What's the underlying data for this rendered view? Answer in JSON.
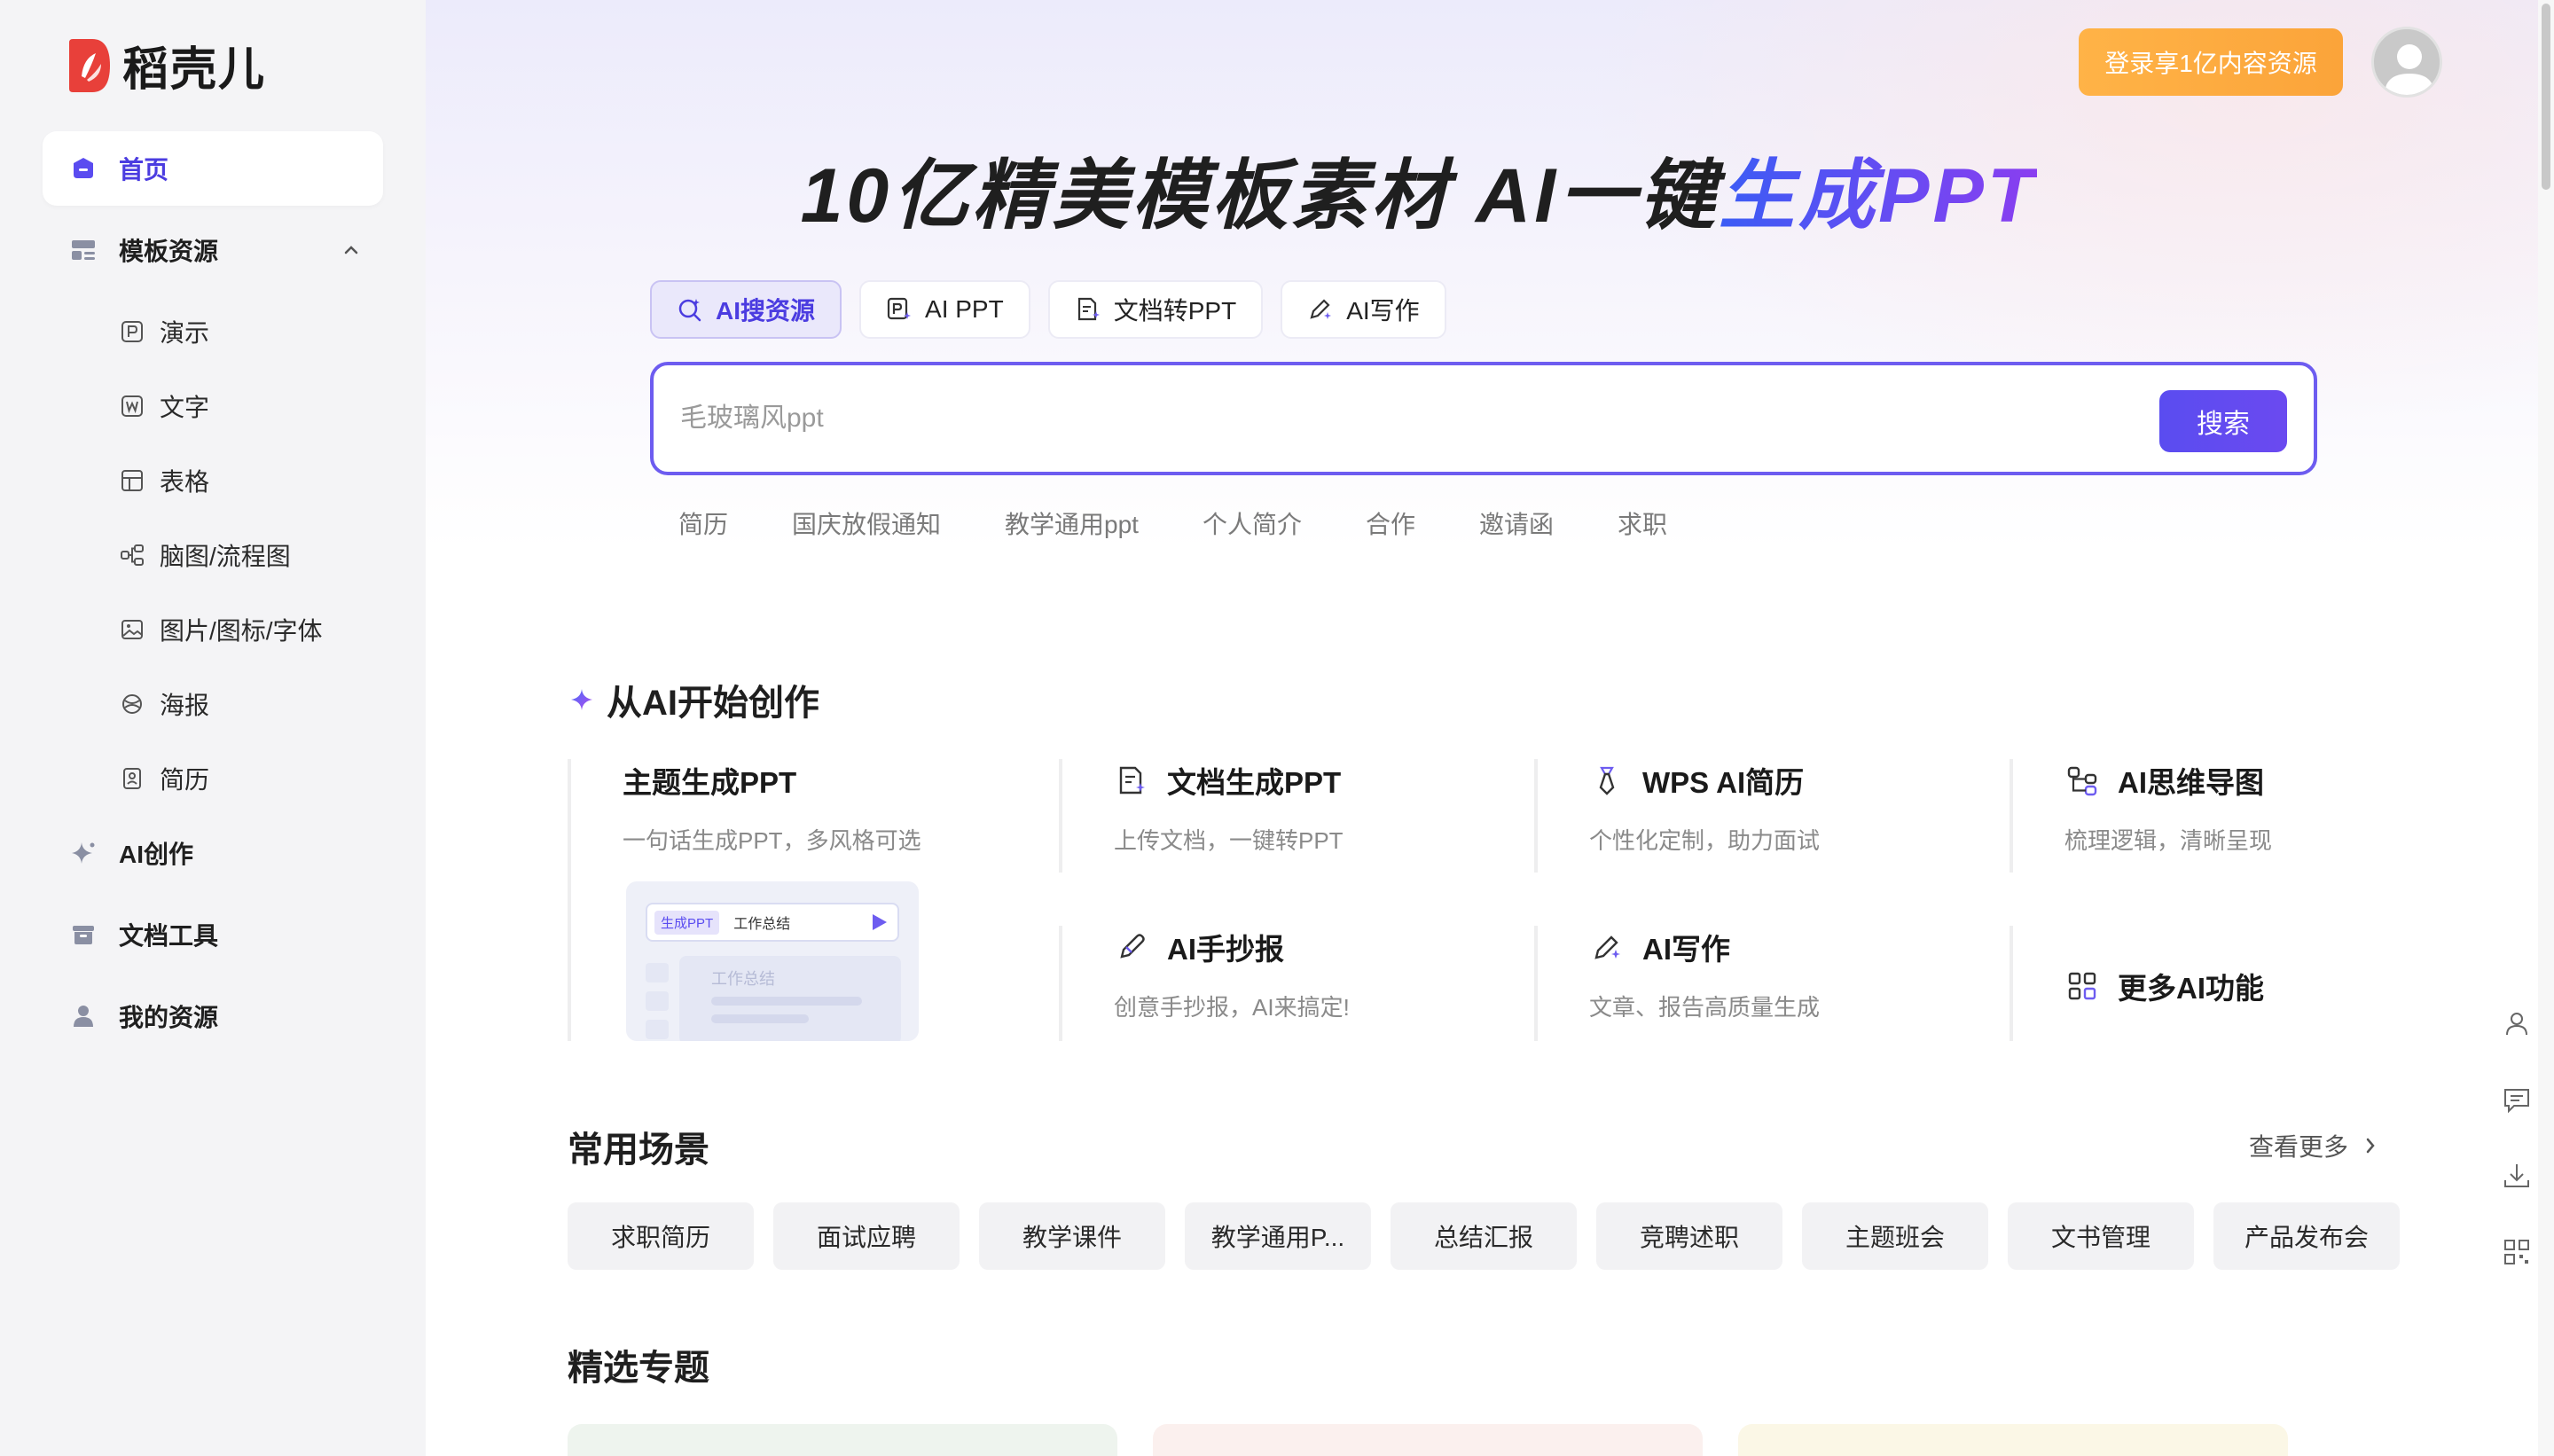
{
  "brand": {
    "name": "稻壳儿"
  },
  "sidebar": {
    "items": [
      {
        "label": "首页",
        "icon": "home-icon",
        "active": true
      },
      {
        "label": "模板资源",
        "icon": "template-icon",
        "expanded": true
      },
      {
        "label": "AI创作",
        "icon": "sparkle-icon"
      },
      {
        "label": "文档工具",
        "icon": "toolbox-icon"
      },
      {
        "label": "我的资源",
        "icon": "user-icon"
      }
    ],
    "sub_items": [
      {
        "label": "演示",
        "icon": "presentation-icon"
      },
      {
        "label": "文字",
        "icon": "word-doc-icon"
      },
      {
        "label": "表格",
        "icon": "table-icon"
      },
      {
        "label": "脑图/流程图",
        "icon": "mindmap-icon"
      },
      {
        "label": "图片/图标/字体",
        "icon": "image-icon"
      },
      {
        "label": "海报",
        "icon": "poster-icon"
      },
      {
        "label": "简历",
        "icon": "resume-icon"
      }
    ]
  },
  "header": {
    "login_label": "登录享1亿内容资源",
    "title_main": "10亿精美模板素材 AI一键",
    "title_accent": "生成PPT"
  },
  "search": {
    "tabs": [
      {
        "label": "AI搜资源",
        "icon": "ai-search-icon",
        "active": true
      },
      {
        "label": "AI PPT",
        "icon": "ai-ppt-icon"
      },
      {
        "label": "文档转PPT",
        "icon": "doc-convert-icon"
      },
      {
        "label": "AI写作",
        "icon": "ai-write-icon"
      }
    ],
    "placeholder": "毛玻璃风ppt",
    "button_label": "搜索",
    "hot_words": [
      "简历",
      "国庆放假通知",
      "教学通用ppt",
      "个人简介",
      "合作",
      "邀请函",
      "求职"
    ]
  },
  "ai_section": {
    "title": "从AI开始创作",
    "features": [
      {
        "title": "主题生成PPT",
        "desc": "一句话生成PPT，多风格可选",
        "icon": ""
      },
      {
        "title": "文档生成PPT",
        "desc": "上传文档，一键转PPT",
        "icon": "doc-ppt-icon"
      },
      {
        "title": "WPS AI简历",
        "desc": "个性化定制，助力面试",
        "icon": "tie-icon"
      },
      {
        "title": "AI思维导图",
        "desc": "梳理逻辑，清晰呈现",
        "icon": "mindmap-icon"
      },
      {
        "title": "AI手抄报",
        "desc": "创意手抄报，AI来搞定!",
        "icon": "pen-icon"
      },
      {
        "title": "AI写作",
        "desc": "文章、报告高质量生成",
        "icon": "ai-write-icon"
      },
      {
        "title": "更多AI功能",
        "desc": "",
        "icon": "grid-icon"
      }
    ],
    "mock": {
      "tag": "生成PPT",
      "input_text": "工作总结",
      "panel_text": "工作总结"
    }
  },
  "scenes": {
    "title": "常用场景",
    "more_label": "查看更多",
    "tags": [
      "求职简历",
      "面试应聘",
      "教学课件",
      "教学通用P...",
      "总结汇报",
      "竞聘述职",
      "主题班会",
      "文书管理",
      "产品发布会"
    ]
  },
  "topics": {
    "title": "精选专题"
  },
  "float_tools": [
    "person-icon",
    "feedback-icon",
    "download-icon",
    "qrcode-icon"
  ],
  "colors": {
    "accent": "#5a4cf0",
    "login": "#fba43a",
    "sidebar_bg": "#f4f4f6"
  }
}
